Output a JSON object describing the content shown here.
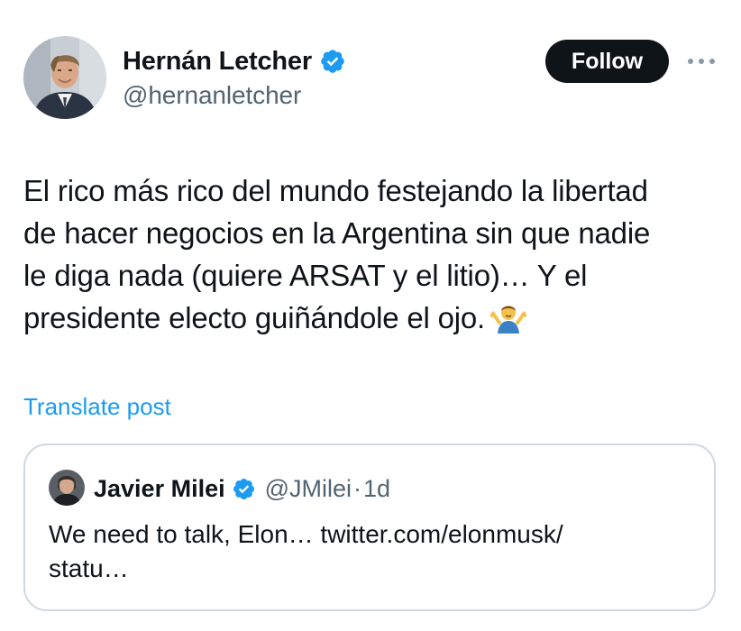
{
  "author": {
    "name": "Hernán Letcher",
    "handle": "@hernanletcher",
    "verified": true,
    "avatar_icon": "profile-photo"
  },
  "actions": {
    "follow_label": "Follow",
    "more_icon": "more-horizontal-icon"
  },
  "tweet": {
    "text": "El rico más rico del mundo festejando la libertad\nde hacer negocios en la Argentina sin que nadie\nle diga nada (quiere ARSAT y el litio)… Y el\npresidente electo guiñándole el ojo.",
    "emoji": "person-shrugging-emoji"
  },
  "translate_label": "Translate post",
  "quoted": {
    "name": "Javier Milei",
    "handle": "@JMilei",
    "separator": "·",
    "time": "1d",
    "text": "We need to talk, Elon… twitter.com/elonmusk/\nstatu…",
    "verified": true
  },
  "colors": {
    "text": "#0f1419",
    "secondary": "#536471",
    "link": "#1d9bf0",
    "verified": "#1d9bf0",
    "border": "#cfd9de",
    "follow_bg": "#0f1419"
  }
}
